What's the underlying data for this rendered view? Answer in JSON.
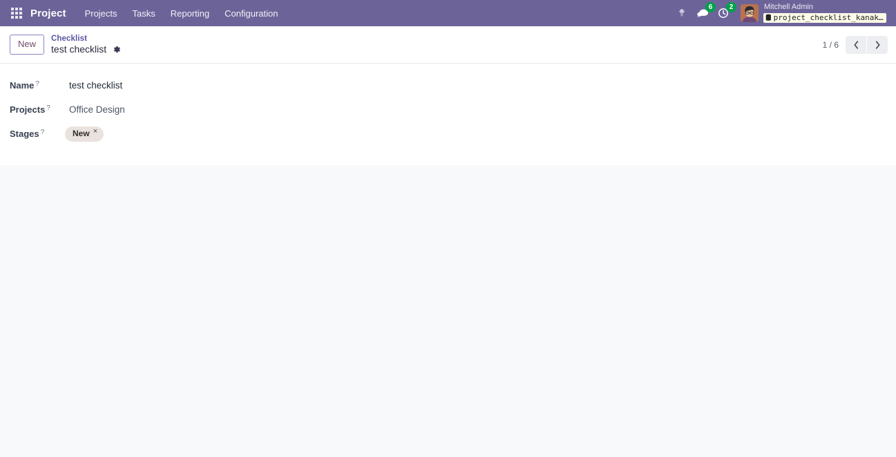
{
  "navbar": {
    "apps_icon": "apps-grid-icon",
    "brand": "Project",
    "menu_items": [
      {
        "label": "Projects"
      },
      {
        "label": "Tasks"
      },
      {
        "label": "Reporting"
      },
      {
        "label": "Configuration"
      }
    ],
    "systray": {
      "debug_icon": "bug-icon",
      "messages_icon": "messages-icon",
      "messages_count": "6",
      "activities_icon": "clock-icon",
      "activities_count": "2"
    },
    "user": {
      "avatar": "user-avatar",
      "name": "Mitchell Admin",
      "database_icon": "database-icon",
      "database": "project_checklist_kanak_…"
    },
    "colors": {
      "navbar_bg": "#6c6499",
      "badge_green": "#00a04a",
      "db_badge_bg": "#fdfbe8"
    }
  },
  "control_panel": {
    "new_button": "New",
    "breadcrumb": {
      "parent": "Checklist",
      "current": "test checklist",
      "settings_icon": "gear-icon"
    },
    "pager": {
      "value": "1 / 6",
      "previous_icon": "chevron-left-icon",
      "next_icon": "chevron-right-icon"
    }
  },
  "form": {
    "fields": [
      {
        "label": "Name",
        "help": "?",
        "value": "test checklist",
        "type": "text"
      },
      {
        "label": "Projects",
        "help": "?",
        "value": "Office Design",
        "type": "many2one"
      },
      {
        "label": "Stages",
        "help": "?",
        "type": "tags",
        "tags": [
          {
            "label": "New",
            "remove_icon": "×"
          }
        ]
      }
    ]
  },
  "colors": {
    "accent_purple": "#714b67",
    "breadcrumb_link": "#5a55a3",
    "tag_bg": "#e9e2de",
    "page_bg": "#f8f9fa"
  }
}
